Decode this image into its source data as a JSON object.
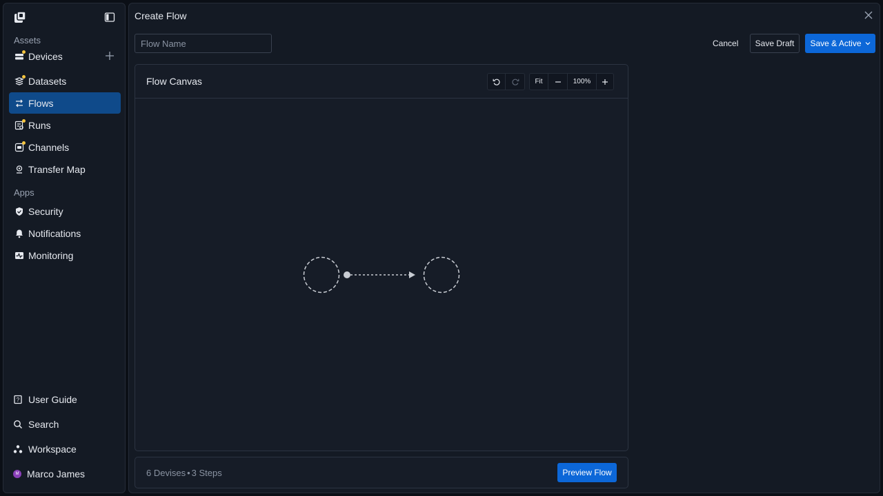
{
  "sidebar": {
    "sections": [
      {
        "title": "Assets",
        "items": [
          {
            "label": "Devices",
            "icon": "devices-icon"
          },
          {
            "label": "Datasets",
            "icon": "datasets-icon"
          },
          {
            "label": "Flows",
            "icon": "flows-icon",
            "active": true
          },
          {
            "label": "Runs",
            "icon": "runs-icon"
          },
          {
            "label": "Channels",
            "icon": "channels-icon"
          },
          {
            "label": "Transfer Map",
            "icon": "map-pin-icon"
          }
        ]
      },
      {
        "title": "Apps",
        "items": [
          {
            "label": "Security",
            "icon": "shield-icon"
          },
          {
            "label": "Notifications",
            "icon": "bell-icon"
          },
          {
            "label": "Monitoring",
            "icon": "monitoring-icon"
          }
        ]
      }
    ],
    "bottom": [
      {
        "label": "User Guide",
        "icon": "book-icon"
      },
      {
        "label": "Search",
        "icon": "search-icon"
      },
      {
        "label": "Workspace",
        "icon": "workspace-icon"
      },
      {
        "label": "Marco James",
        "icon": "avatar",
        "initial": "M"
      }
    ]
  },
  "header": {
    "title": "Create Flow",
    "flow_name_placeholder": "Flow Name",
    "cancel_label": "Cancel",
    "save_draft_label": "Save Draft",
    "save_active_label": "Save & Active"
  },
  "canvas": {
    "title": "Flow Canvas",
    "fit_label": "Fit",
    "zoom": "100%"
  },
  "footer": {
    "devices": "6 Devises",
    "separator": "•",
    "steps": "3 Steps",
    "preview_label": "Preview Flow"
  },
  "colors": {
    "accent": "#0c67d8",
    "active_nav": "#0f4a8a",
    "badge": "#f6c53f",
    "avatar": "#8a3fb8"
  }
}
